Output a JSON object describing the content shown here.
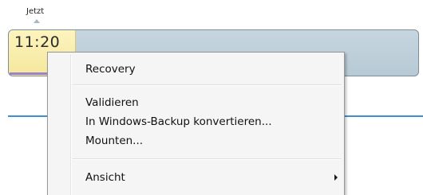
{
  "timeline": {
    "now_label": "Jetzt",
    "current_time": "11:20"
  },
  "context_menu": {
    "items": [
      {
        "label": "Recovery"
      },
      {
        "label": "Validieren"
      },
      {
        "label": "In Windows-Backup konvertieren..."
      },
      {
        "label": "Mounten..."
      },
      {
        "label": "Ansicht",
        "has_submenu": true
      }
    ]
  },
  "colors": {
    "timeline_fill": "#c6d6e0",
    "time_block_fill": "#fdf4bf",
    "time_underline": "#9c83c7",
    "accent_line": "#3f8fd1",
    "menu_background": "#f5f5f5"
  },
  "icons": {
    "now_marker": "triangle-up-icon",
    "submenu_arrow": "triangle-right-icon"
  }
}
